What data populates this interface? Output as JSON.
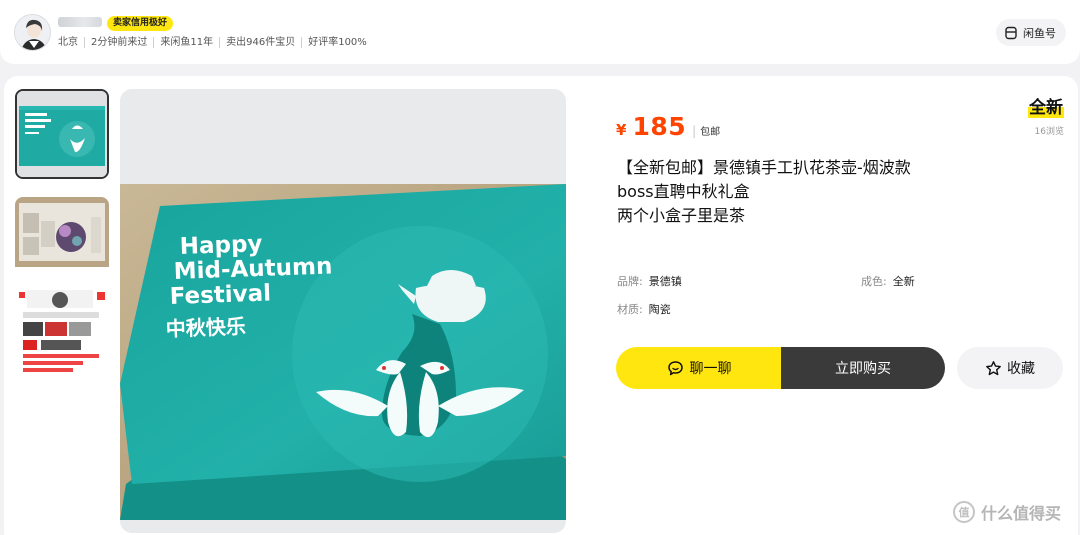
{
  "seller": {
    "credit_badge": "卖家信用极好",
    "stats": [
      "北京",
      "2分钟前来过",
      "来闲鱼11年",
      "卖出946件宝贝",
      "好评率100%"
    ],
    "xianyu_label": "闲鱼号"
  },
  "product": {
    "price_symbol": "¥",
    "price": "185",
    "shipping": "包邮",
    "condition_tag": "全新",
    "views": "16浏览",
    "description": "【全新包邮】景德镇手工扒花茶壶-烟波款\nboss直聘中秋礼盒\n两个小盒子里是茶",
    "specs": {
      "brand_key": "品牌:",
      "brand_val": "景德镇",
      "cond_key": "成色:",
      "cond_val": "全新",
      "mat_key": "材质:",
      "mat_val": "陶瓷"
    }
  },
  "box_print": {
    "line1": "Happy",
    "line2": "Mid-Autumn",
    "line3": "Festival",
    "cn": "中秋快乐"
  },
  "actions": {
    "chat": "聊一聊",
    "buy": "立即购买",
    "favorite": "收藏"
  },
  "watermark": {
    "glyph": "值",
    "text": "什么值得买"
  },
  "colors": {
    "brand_yellow": "#ffe60f",
    "price_orange": "#ff4400",
    "box_teal": "#1faaa3",
    "buy_dark": "#3a3a3a"
  },
  "icons": [
    "avatar",
    "xianyu-id-icon",
    "chat-bubble-icon",
    "star-icon",
    "smzdm-logo-icon"
  ]
}
